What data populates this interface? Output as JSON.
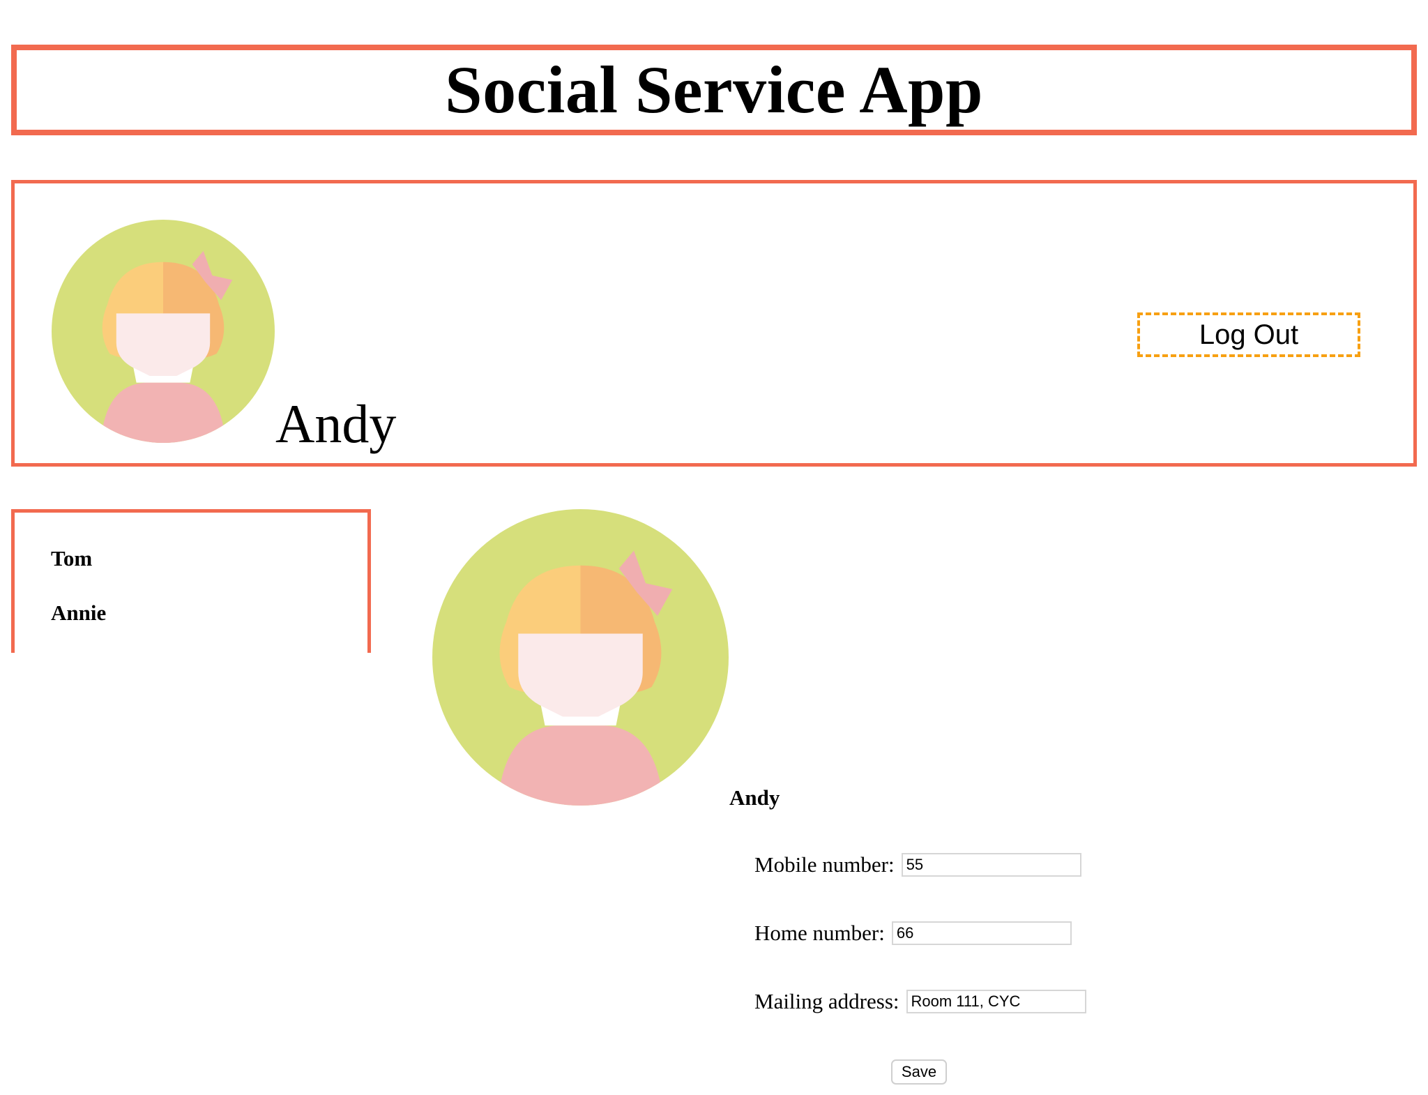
{
  "app": {
    "title": "Social Service App"
  },
  "current_user": {
    "name": "Andy",
    "avatar_icon": "girl-avatar-icon"
  },
  "header": {
    "logout_label": "Log Out"
  },
  "contacts": [
    {
      "name": "Tom"
    },
    {
      "name": "Annie"
    }
  ],
  "profile": {
    "name": "Andy",
    "avatar_icon": "girl-avatar-icon",
    "fields": [
      {
        "label": "Mobile number:",
        "value": "55"
      },
      {
        "label": "Home number:",
        "value": "66"
      },
      {
        "label": "Mailing address:",
        "value": "Room 111, CYC"
      }
    ],
    "save_label": "Save"
  },
  "colors": {
    "border_accent": "#f26a4f",
    "logout_border": "#f7a012",
    "avatar_bg": "#d6df7b",
    "avatar_hair_light": "#fbcd7b",
    "avatar_hair_dark": "#f6b873",
    "avatar_face": "#fbeaea",
    "avatar_shirt": "#f2b3b3",
    "avatar_bow": "#f0aeb0"
  }
}
